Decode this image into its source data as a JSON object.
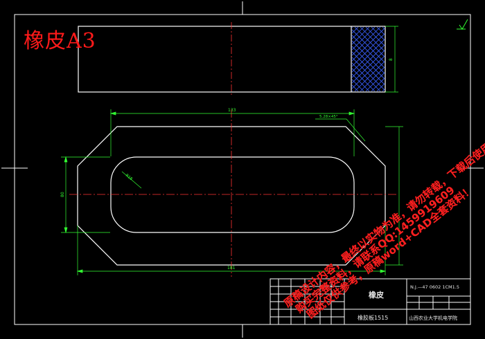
{
  "drawing": {
    "title_overlay": "橡皮A3",
    "part_name": "橡皮",
    "material": "橡胶板1515",
    "school": "山西农业大学机电学院",
    "drawing_number": "N.J.—47 0602 1CM1.5"
  },
  "watermark": {
    "line1": "原稿设计内容，最终以实物为准，请勿转载，下载后使用参考！",
    "line2": "购买完整资料，请联系QQ:1459919609",
    "line3": "图纸仅供参考，原稿word+CAD全套资料！"
  },
  "dimensions": {
    "overall_length": "181",
    "top_width": "133",
    "height": "80",
    "hole_radius": "R18",
    "chamfer": "5.28×45°",
    "side_thickness": "8"
  },
  "colors": {
    "background": "#000000",
    "outline": "#ffffff",
    "dimension": "#33ff33",
    "centerline": "#ff3333",
    "hatch": "#3a60ff",
    "text_red": "#ff1a1a"
  }
}
